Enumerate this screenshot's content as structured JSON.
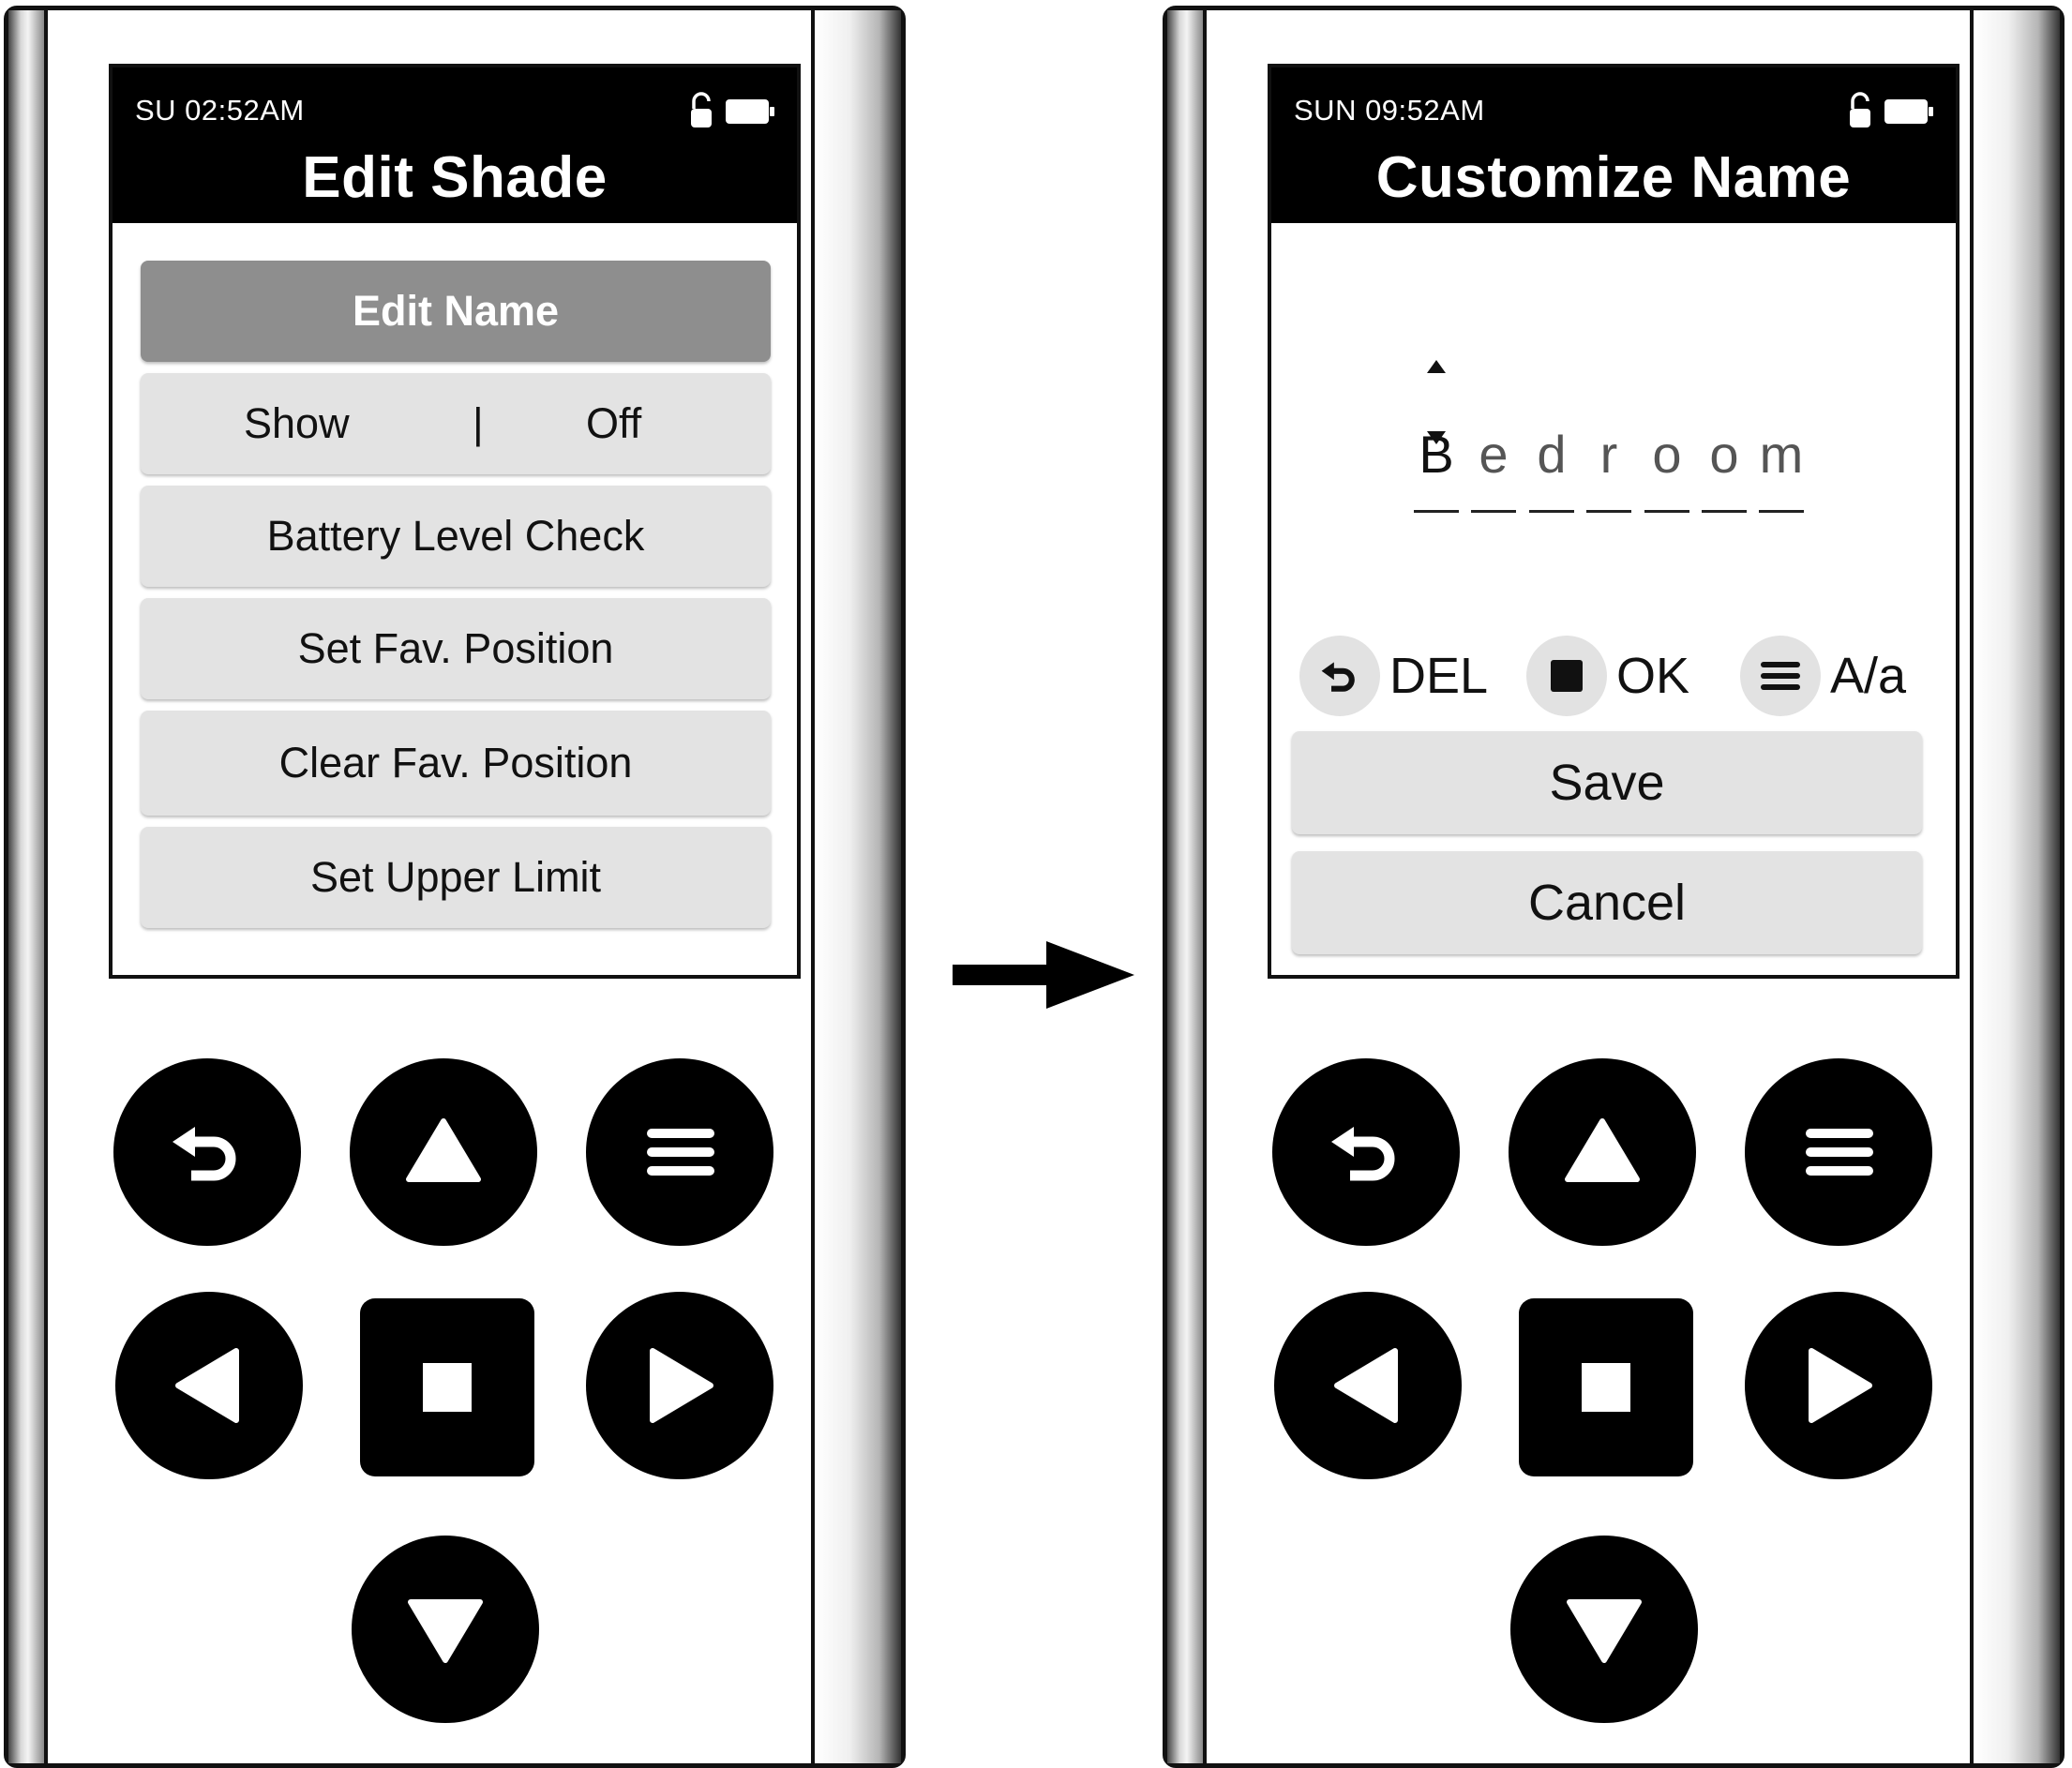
{
  "left_screen": {
    "status_time": "SU 02:52AM",
    "title": "Edit Shade",
    "menu": [
      {
        "label": "Edit Name",
        "selected": true
      },
      {
        "label": "Show",
        "toggle_separator": "|",
        "toggle_value": "Off"
      },
      {
        "label": "Battery Level Check"
      },
      {
        "label": "Set Fav. Position"
      },
      {
        "label": "Clear Fav. Position"
      },
      {
        "label": "Set Upper Limit"
      }
    ]
  },
  "right_screen": {
    "status_time": "SUN 09:52AM",
    "title": "Customize Name",
    "name_chars": [
      "B",
      "e",
      "d",
      "r",
      "o",
      "o",
      "m"
    ],
    "active_char_index": 0,
    "hints": [
      {
        "icon": "back-icon",
        "label": "DEL"
      },
      {
        "icon": "stop-icon",
        "label": "OK"
      },
      {
        "icon": "menu-icon",
        "label": "A/a"
      }
    ],
    "buttons": {
      "save": "Save",
      "cancel": "Cancel"
    }
  },
  "status_icons": [
    "unlock-icon",
    "battery-icon"
  ],
  "keypad": [
    "back-icon",
    "up-arrow-icon",
    "menu-icon",
    "left-arrow-icon",
    "stop-icon",
    "right-arrow-icon",
    "down-arrow-icon"
  ],
  "colors": {
    "header": "#000000",
    "menu_item": "#e3e3e3",
    "selected_item": "#8e8e8e",
    "key": "#000000"
  }
}
